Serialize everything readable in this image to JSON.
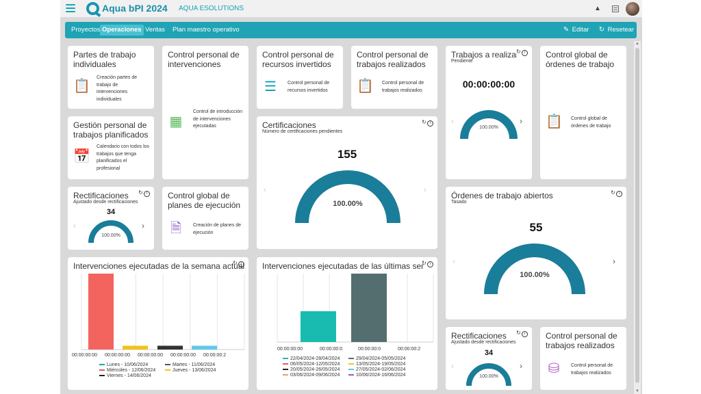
{
  "app": {
    "brand": "Aqua bPI 2024",
    "org": "AQUA ESOLUTIONS"
  },
  "nav": {
    "items": [
      "Proyectos",
      "Operaciones",
      "Ventas",
      "Plan maestro operativo"
    ],
    "active": "Operaciones",
    "edit_label": "Editar",
    "reset_label": "Resetear"
  },
  "colors": {
    "accent": "#1fa3b5",
    "gauge": "#1a7d99"
  },
  "cards": {
    "partes": {
      "title": "Partes de trabajo individuales",
      "desc": "Creación partes de trabajo de intervenciones individuales",
      "icon": "clipboard-icon"
    },
    "gestion": {
      "title": "Gestión personal de trabajos planificados",
      "desc": "Calendario con todos los trabajos que tenga planificados el profesional",
      "icon": "calendar-icon"
    },
    "control_interv": {
      "title": "Control personal de intervenciones",
      "desc": "Control de introducción de intervenciones ejecutadas",
      "icon": "spreadsheet-icon"
    },
    "control_recursos": {
      "title": "Control personal de recursos invertidos",
      "desc": "Control personal de recursos invertidos",
      "icon": "list-icon"
    },
    "control_trabajos": {
      "title": "Control personal de trabajos realizados",
      "desc": "Control personal de trabajos realizados",
      "icon": "clipboard-icon"
    },
    "control_global_ordenes": {
      "title": "Control global de órdenes de trabajo",
      "desc": "Control global de órdenes de trabajo",
      "icon": "clipboard-icon"
    },
    "control_global_planes": {
      "title": "Control global de planes de ejecución",
      "desc": "Creación de planes de ejecución",
      "icon": "document-chart-icon"
    },
    "control_trabajos_2": {
      "title": "Control personal de trabajos realizados",
      "desc": "Control personal de trabajos realizados",
      "icon": "database-icon"
    }
  },
  "widgets": {
    "trabajos": {
      "title": "Trabajos a realizar...",
      "subtitle": "Pendiente",
      "value": "00:00:00:00",
      "pct": "100.00%",
      "fraction": 1.0
    },
    "certificaciones": {
      "title": "Certificaciones",
      "subtitle": "Número de certificaciones pendientes",
      "value": "155",
      "pct": "100.00%",
      "fraction": 1.0
    },
    "rectificaciones": {
      "title": "Rectificaciones",
      "subtitle": "Ajustado desde rectificaciones",
      "value": "34",
      "pct": "100.00%",
      "fraction": 1.0
    },
    "ordenes": {
      "title": "Órdenes de trabajo abiertos",
      "subtitle": "Tasado",
      "value": "55",
      "pct": "100.00%",
      "fraction": 1.0
    },
    "rectificaciones_2": {
      "title": "Rectificaciones",
      "subtitle": "Ajustado desde rectificaciones",
      "value": "34",
      "pct": "100.00%",
      "fraction": 1.0
    }
  },
  "chart_data": [
    {
      "type": "bar",
      "title": "Intervenciones ejecutadas de la semana actual",
      "categories": [
        "Lunes - 10/06/2024",
        "Martes - 11/06/2024",
        "Miércoles - 12/06/2024",
        "Jueves - 13/06/2024",
        "Viernes - 14/06/2024"
      ],
      "x_tick_labels": [
        "00:00:00:00",
        "00:00:00:00",
        "00:00:00:00",
        "00:00:00:00",
        "00:00:00:2"
      ],
      "values": [
        1.0,
        0.05,
        0.05,
        0.05
      ],
      "series_colors": [
        "#f4645e",
        "#f2c318",
        "#333333",
        "#5fc8e8"
      ],
      "legend": [
        {
          "label": "Lunes - 10/06/2024",
          "color": "#00b0a6"
        },
        {
          "label": "Martes - 11/06/2024",
          "color": "#555555"
        },
        {
          "label": "Miércoles - 12/06/2024",
          "color": "#e05a5a"
        },
        {
          "label": "Jueves - 13/06/2024",
          "color": "#f2c318"
        },
        {
          "label": "Viernes - 14/06/2024",
          "color": "#222222"
        }
      ],
      "grid": true
    },
    {
      "type": "bar",
      "title": "Intervenciones ejecutadas de las últimas sema...",
      "x_tick_labels": [
        "00:00:00:00",
        "00:00:00:0",
        "00:00:00:0",
        "00:00:00:2"
      ],
      "values": [
        0.45,
        1.0
      ],
      "series_colors": [
        "#19bbb0",
        "#546e70"
      ],
      "legend": [
        {
          "label": "22/04/2024-28/04/2024",
          "color": "#19bbb0"
        },
        {
          "label": "29/04/2024-05/05/2024",
          "color": "#546e70"
        },
        {
          "label": "06/05/2024-12/05/2024",
          "color": "#e05a5a"
        },
        {
          "label": "13/05/2024-19/05/2024",
          "color": "#f2c318"
        },
        {
          "label": "20/05/2024-26/05/2024",
          "color": "#222222"
        },
        {
          "label": "27/05/2024-02/06/2024",
          "color": "#5fc8e8"
        },
        {
          "label": "03/06/2024-09/06/2024",
          "color": "#f0a060"
        },
        {
          "label": "10/06/2024-16/06/2024",
          "color": "#8a5cc0"
        }
      ],
      "grid": true
    }
  ]
}
